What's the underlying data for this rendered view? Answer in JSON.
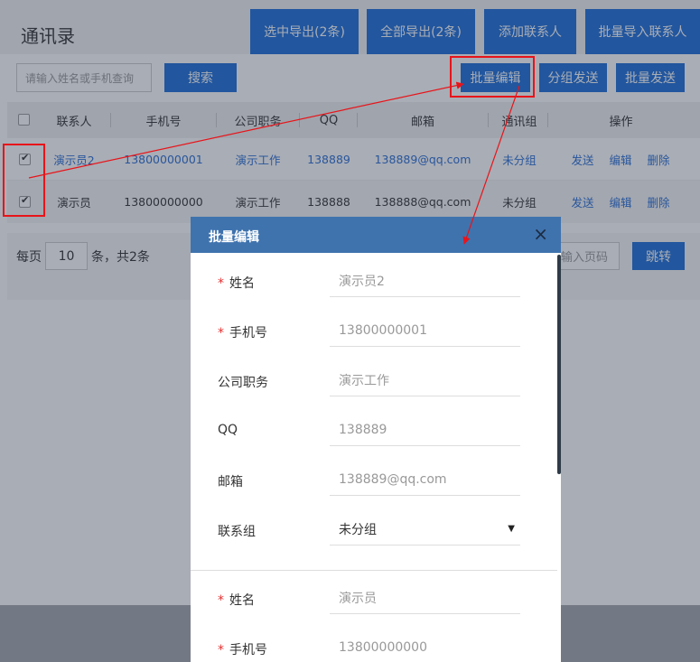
{
  "header": {
    "title": "通讯录",
    "buttons": [
      "选中导出(2条)",
      "全部导出(2条)",
      "添加联系人",
      "批量导入联系人"
    ]
  },
  "toolbar": {
    "search_placeholder": "请输入姓名或手机查询",
    "search_button": "搜索",
    "batch_edit": "批量编辑",
    "group_send": "分组发送",
    "batch_send": "批量发送"
  },
  "table": {
    "headers": [
      "联系人",
      "手机号",
      "公司职务",
      "QQ",
      "邮箱",
      "通讯组",
      "操作"
    ],
    "rows": [
      {
        "checked": true,
        "name": "演示员2",
        "phone": "13800000001",
        "job": "演示工作",
        "qq": "138889",
        "email": "138889@qq.com",
        "group": "未分组"
      },
      {
        "checked": true,
        "name": "演示员",
        "phone": "13800000000",
        "job": "演示工作",
        "qq": "138888",
        "email": "138888@qq.com",
        "group": "未分组"
      }
    ],
    "actions": [
      "发送",
      "编辑",
      "删除"
    ]
  },
  "pager": {
    "per_page_prefix": "每页",
    "per_page": "10",
    "per_page_suffix": "条，共2条",
    "page_input_placeholder": "输入页码",
    "jump": "跳转"
  },
  "modal": {
    "title": "批量编辑",
    "close": "×",
    "record1": {
      "name_label": "姓名",
      "name": "演示员2",
      "phone_label": "手机号",
      "phone": "13800000001",
      "job_label": "公司职务",
      "job": "演示工作",
      "qq_label": "QQ",
      "qq": "138889",
      "email_label": "邮箱",
      "email": "138889@qq.com",
      "group_label": "联系组",
      "group": "未分组"
    },
    "record2": {
      "name_label": "姓名",
      "name": "演示员",
      "phone_label": "手机号",
      "phone": "13800000000"
    },
    "required_mark": "*"
  }
}
